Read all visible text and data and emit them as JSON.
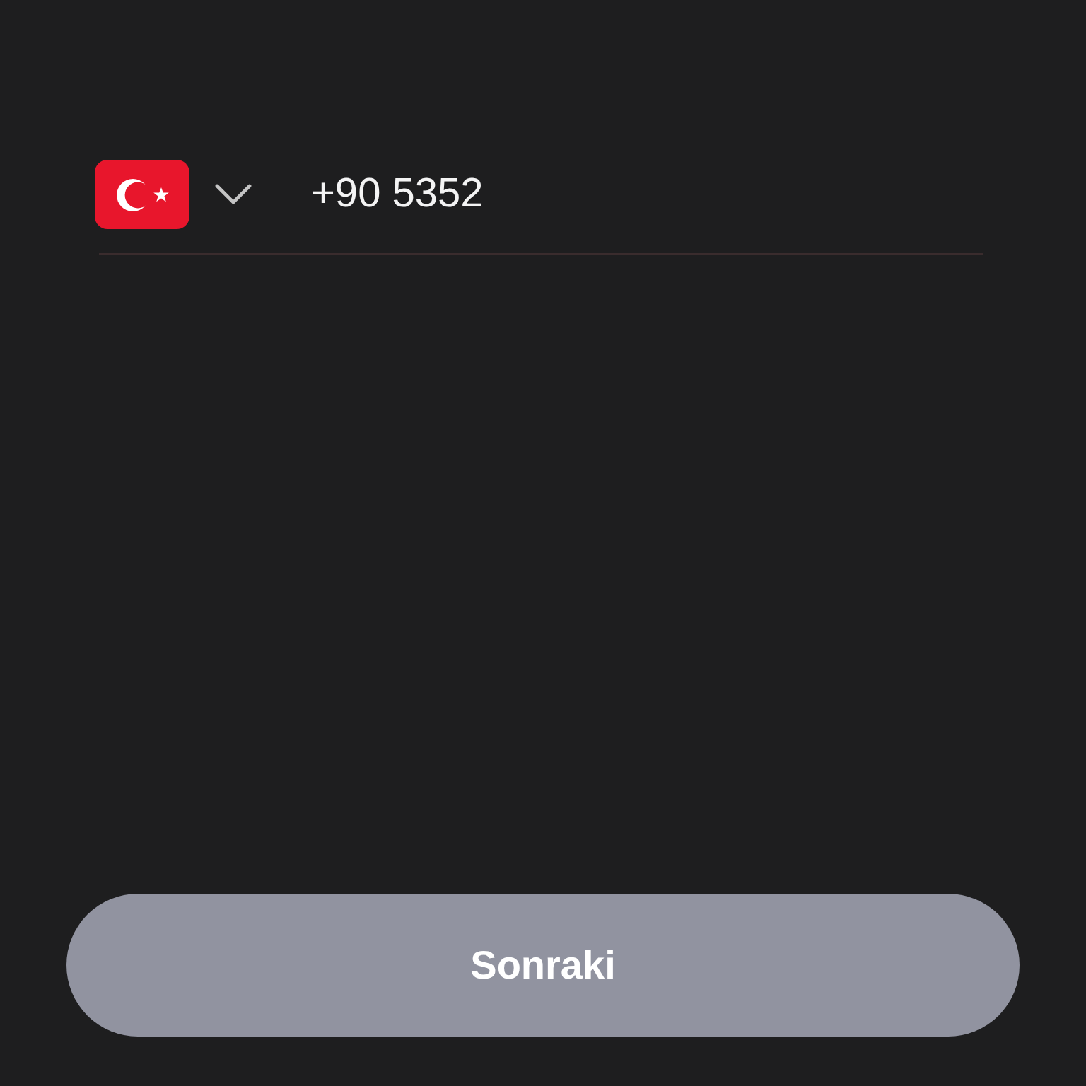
{
  "country_selector": {
    "expanded": false
  },
  "phone_field": {
    "value": "+90 5352"
  },
  "next_button": {
    "label": "Sonraki",
    "disabled": true
  }
}
